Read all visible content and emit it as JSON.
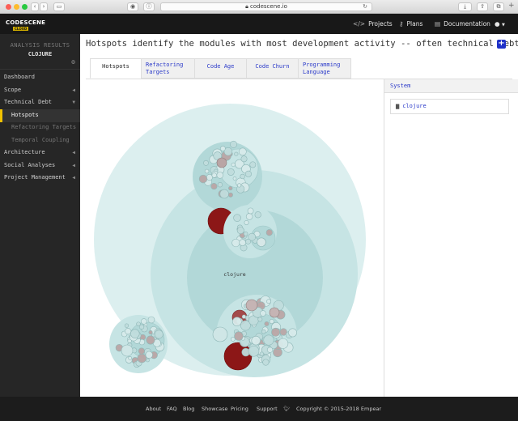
{
  "browser": {
    "url": "codescene.io"
  },
  "app": {
    "logo": "CODESCENE",
    "logo_badge": "CLOUD"
  },
  "topnav": {
    "projects": "Projects",
    "plans": "Plans",
    "documentation": "Documentation"
  },
  "sidebar": {
    "title": "ANALYSIS RESULTS",
    "project": "CLOJURE",
    "items": [
      {
        "label": "Dashboard"
      },
      {
        "label": "Scope"
      },
      {
        "label": "Technical Debt"
      },
      {
        "label": "Hotspots"
      },
      {
        "label": "Refactoring Targets"
      },
      {
        "label": "Temporal Coupling"
      },
      {
        "label": "Architecture"
      },
      {
        "label": "Social Analyses"
      },
      {
        "label": "Project Management"
      }
    ]
  },
  "main": {
    "headline": "Hotspots identify the modules with most development activity -- often technical debt.",
    "tabs": [
      {
        "line1": "Hotspots",
        "line2": ""
      },
      {
        "line1": "Refactoring",
        "line2": "Targets"
      },
      {
        "line1": "Code Age",
        "line2": ""
      },
      {
        "line1": "Code Churn",
        "line2": ""
      },
      {
        "line1": "Programming",
        "line2": "Language"
      }
    ],
    "viz_label": "clojure",
    "system": {
      "header": "System",
      "folder": "clojure"
    }
  },
  "footer": {
    "links": [
      "About",
      "FAQ",
      "Blog",
      "Showcase",
      "Pricing",
      "Support"
    ],
    "copyright": "Copyright © 2015-2018 Empear"
  }
}
